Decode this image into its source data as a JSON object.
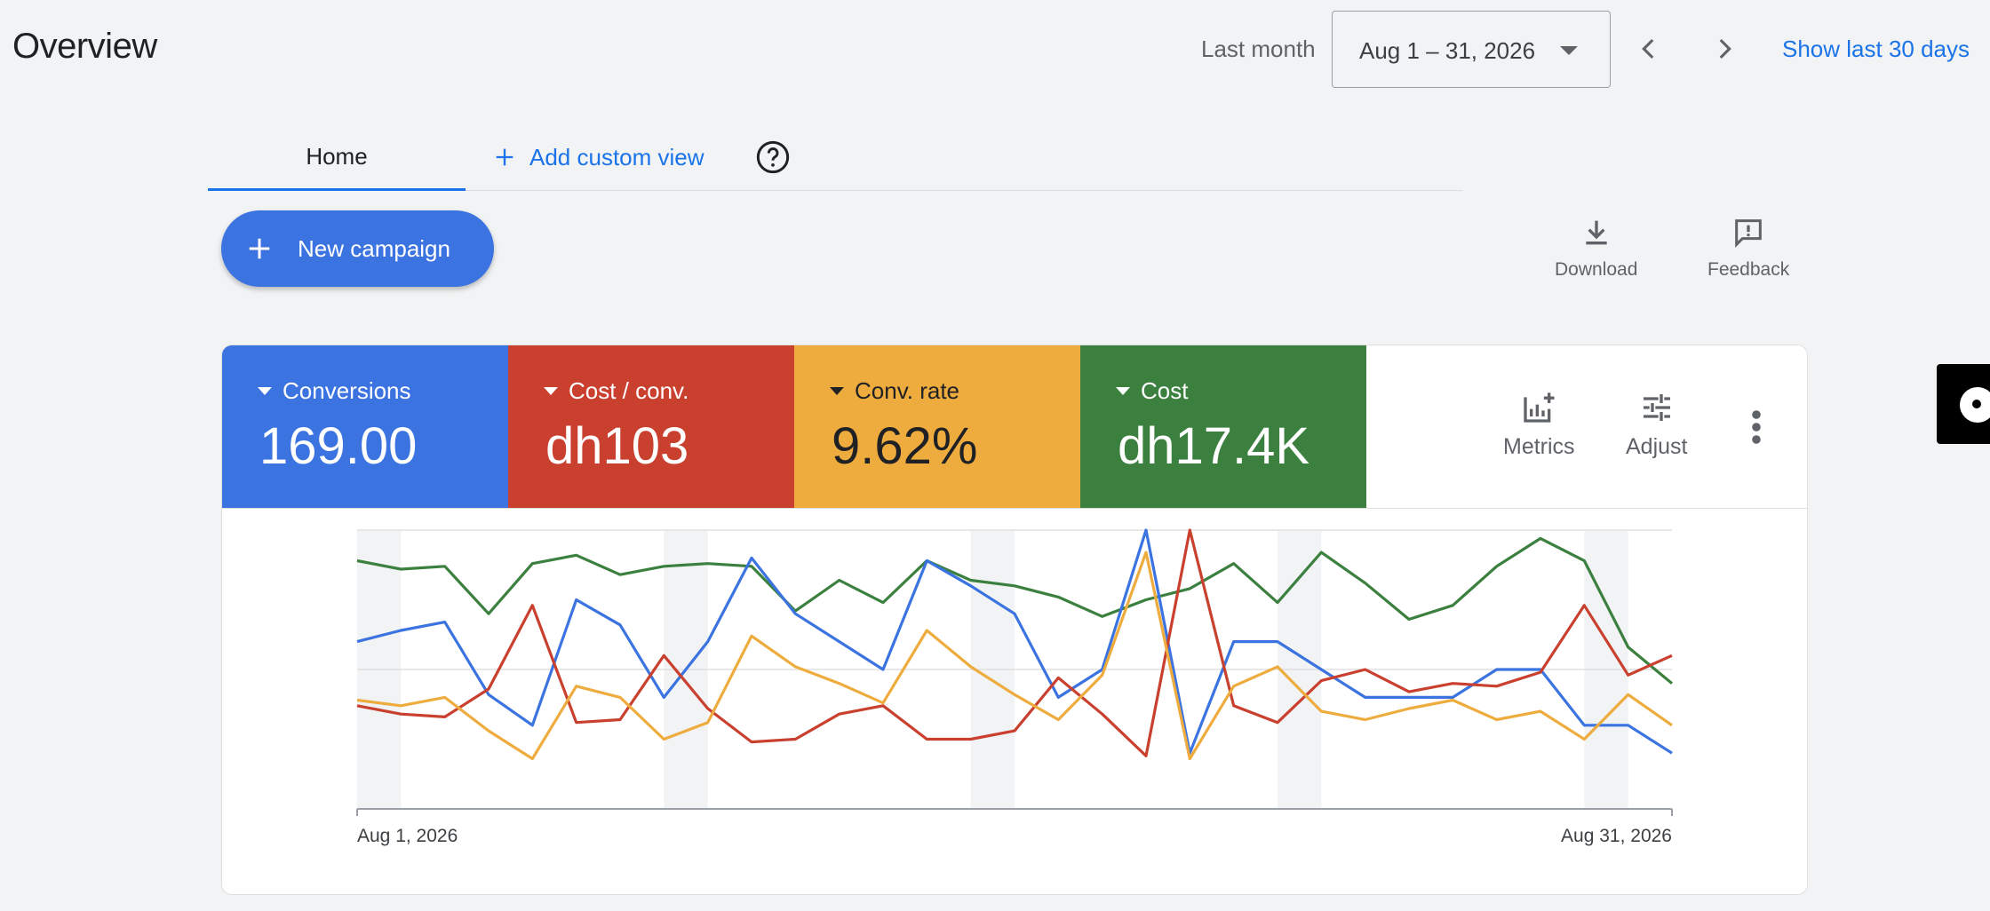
{
  "header": {
    "title": "Overview",
    "date_range_label": "Last month",
    "date_range_value": "Aug 1 – 31, 2026",
    "show_last": "Show last 30 days"
  },
  "tabs": {
    "home": "Home",
    "add_custom_view": "Add custom view"
  },
  "actions": {
    "new_campaign": "New campaign",
    "download": "Download",
    "feedback": "Feedback"
  },
  "metrics": [
    {
      "label": "Conversions",
      "value": "169.00",
      "color": "#3b73e0"
    },
    {
      "label": "Cost / conv.",
      "value": "dh103",
      "color": "#c9402f"
    },
    {
      "label": "Conv. rate",
      "value": "9.62%",
      "color": "#eeac3e"
    },
    {
      "label": "Cost",
      "value": "dh17.4K",
      "color": "#3c8040"
    }
  ],
  "metric_tools": {
    "metrics": "Metrics",
    "adjust": "Adjust"
  },
  "chart_data": {
    "type": "line",
    "x_start_label": "Aug 1, 2026",
    "x_end_label": "Aug 31, 2026",
    "days": 31,
    "ylim": [
      0,
      1
    ],
    "weekend_bands": [
      [
        1,
        2
      ],
      [
        8,
        9
      ],
      [
        15,
        16
      ],
      [
        22,
        23
      ],
      [
        29,
        30
      ]
    ],
    "series": [
      {
        "color": "#3c8040",
        "values": [
          0.89,
          0.86,
          0.87,
          0.7,
          0.88,
          0.91,
          0.84,
          0.87,
          0.88,
          0.87,
          0.71,
          0.82,
          0.74,
          0.89,
          0.82,
          0.8,
          0.76,
          0.69,
          0.75,
          0.79,
          0.88,
          0.74,
          0.92,
          0.81,
          0.68,
          0.73,
          0.87,
          0.97,
          0.89,
          0.58,
          0.45
        ]
      },
      {
        "color": "#3b73e0",
        "values": [
          0.6,
          0.64,
          0.67,
          0.41,
          0.3,
          0.75,
          0.66,
          0.4,
          0.6,
          0.9,
          0.7,
          0.6,
          0.5,
          0.89,
          0.8,
          0.7,
          0.4,
          0.5,
          1.0,
          0.2,
          0.6,
          0.6,
          0.5,
          0.4,
          0.4,
          0.4,
          0.5,
          0.5,
          0.3,
          0.3,
          0.2
        ]
      },
      {
        "color": "#c9402f",
        "values": [
          0.37,
          0.34,
          0.33,
          0.43,
          0.73,
          0.31,
          0.32,
          0.55,
          0.36,
          0.24,
          0.25,
          0.34,
          0.37,
          0.25,
          0.25,
          0.28,
          0.47,
          0.34,
          0.19,
          1.0,
          0.37,
          0.31,
          0.46,
          0.5,
          0.42,
          0.45,
          0.44,
          0.49,
          0.73,
          0.48,
          0.55
        ]
      },
      {
        "color": "#eeac3e",
        "values": [
          0.39,
          0.37,
          0.4,
          0.28,
          0.18,
          0.44,
          0.4,
          0.25,
          0.31,
          0.62,
          0.51,
          0.45,
          0.38,
          0.64,
          0.51,
          0.41,
          0.32,
          0.48,
          0.92,
          0.18,
          0.44,
          0.51,
          0.35,
          0.32,
          0.36,
          0.39,
          0.32,
          0.35,
          0.25,
          0.41,
          0.3
        ]
      }
    ]
  }
}
